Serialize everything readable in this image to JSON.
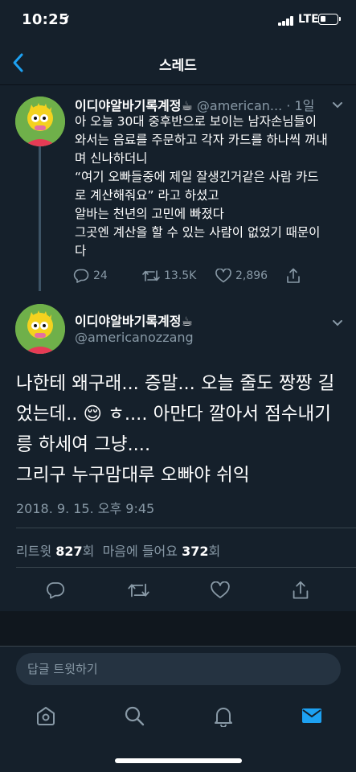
{
  "status_bar": {
    "time": "10:25",
    "network": "LTE"
  },
  "nav": {
    "title": "스레드"
  },
  "reply_tweet": {
    "display_name": "이디야알바기록계정☕",
    "handle": "@american...",
    "time": "· 1일",
    "lines": [
      "아 오늘 30대 중후반으로 보이는 남자손님들이",
      "와서는 음료를 주문하고 각자 카드를 하나씩 꺼내",
      "며 신나하더니",
      "“여기 오빠들중에 제일 잘생긴거같은 사람 카드",
      "로 계산해줘요” 라고 하셨고",
      "알바는 천년의 고민에 빠졌다",
      "그곳엔 계산을 할 수 있는 사람이 없었기 때문이",
      "다"
    ],
    "replies": "24",
    "retweets": "13.5K",
    "likes": "2,896"
  },
  "main_tweet": {
    "display_name": "이디야알바기록계정☕",
    "handle": "@americanozzang",
    "lines": [
      "나한테 왜구래... 증말... 오늘 줄도 짱짱 길",
      "었는데.. 😌 ㅎ.... 아만다 깔아서 점수내기",
      "릉 하세여 그냥....",
      "그리구 누구맘대루 오빠야 쉬익"
    ],
    "timestamp": "2018. 9. 15. 오후 9:45",
    "retweet_label": "리트윗",
    "retweet_count": "827",
    "count_suffix": "회",
    "like_label": "마음에 들어요",
    "like_count": "372"
  },
  "compose": {
    "placeholder": "답글 트윗하기"
  },
  "tabs": [
    "home-icon",
    "search-icon",
    "notifications-icon",
    "messages-icon"
  ],
  "colors": {
    "background": "#15202b",
    "accent": "#1da1f2",
    "muted": "#8899a6"
  }
}
